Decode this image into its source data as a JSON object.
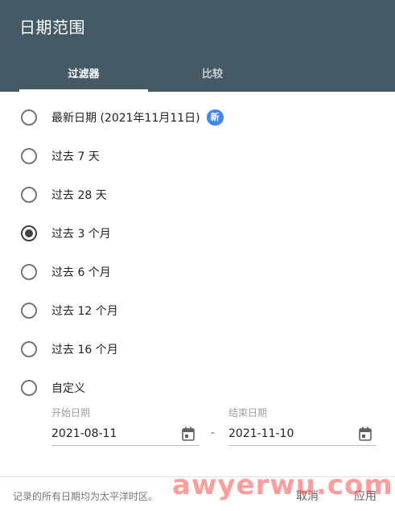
{
  "header": {
    "title": "日期范围",
    "tabs": [
      {
        "label": "过滤器",
        "active": true
      },
      {
        "label": "比较",
        "active": false
      }
    ]
  },
  "options": [
    {
      "label": "最新日期 (2021年11月11日)",
      "badge": "新",
      "checked": false
    },
    {
      "label": "过去 7 天",
      "checked": false
    },
    {
      "label": "过去 28 天",
      "checked": false
    },
    {
      "label": "过去 3 个月",
      "checked": true
    },
    {
      "label": "过去 6 个月",
      "checked": false
    },
    {
      "label": "过去 12 个月",
      "checked": false
    },
    {
      "label": "过去 16 个月",
      "checked": false
    },
    {
      "label": "自定义",
      "checked": false
    }
  ],
  "custom_range": {
    "start_label": "开始日期",
    "start_value": "2021-08-11",
    "separator": "-",
    "end_label": "结束日期",
    "end_value": "2021-11-10"
  },
  "footer": {
    "note": "记录的所有日期均为太平洋时区。",
    "cancel_label": "取消",
    "apply_label": "应用"
  },
  "watermark": "awyerwu.com",
  "colors": {
    "header_bg": "#455a64",
    "badge_bg": "#4285f4",
    "watermark": "#ff4d4d"
  },
  "icons": {
    "date_picker": "calendar-icon"
  }
}
